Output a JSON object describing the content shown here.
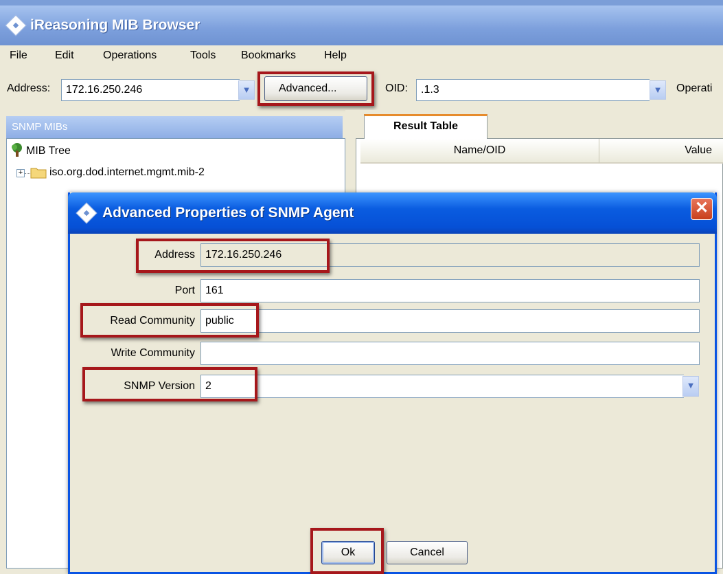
{
  "window": {
    "title": "iReasoning MIB Browser"
  },
  "menu": [
    "File",
    "Edit",
    "Operations",
    "Tools",
    "Bookmarks",
    "Help"
  ],
  "toolbar": {
    "address_label": "Address:",
    "address_value": "172.16.250.246",
    "advanced_label": "Advanced...",
    "oid_label": "OID:",
    "oid_value": ".1.3",
    "operations_label": "Operati"
  },
  "left_panel": {
    "header": "SNMP MIBs",
    "tree_root": "MIB Tree",
    "tree_node": "iso.org.dod.internet.mgmt.mib-2"
  },
  "right_panel": {
    "tab_label": "Result Table",
    "columns": [
      "Name/OID",
      "Value"
    ]
  },
  "dialog": {
    "title": "Advanced Properties of SNMP Agent",
    "fields": {
      "address": {
        "label": "Address",
        "value": "172.16.250.246"
      },
      "port": {
        "label": "Port",
        "value": "161"
      },
      "read_community": {
        "label": "Read Community",
        "value": "public"
      },
      "write_community": {
        "label": "Write Community",
        "value": ""
      },
      "snmp_version": {
        "label": "SNMP Version",
        "value": "2"
      }
    },
    "ok_label": "Ok",
    "cancel_label": "Cancel"
  },
  "colors": {
    "highlight": "#a6171b",
    "dialog_title": "#0a5ce0",
    "window_bg": "#ece9d8"
  }
}
